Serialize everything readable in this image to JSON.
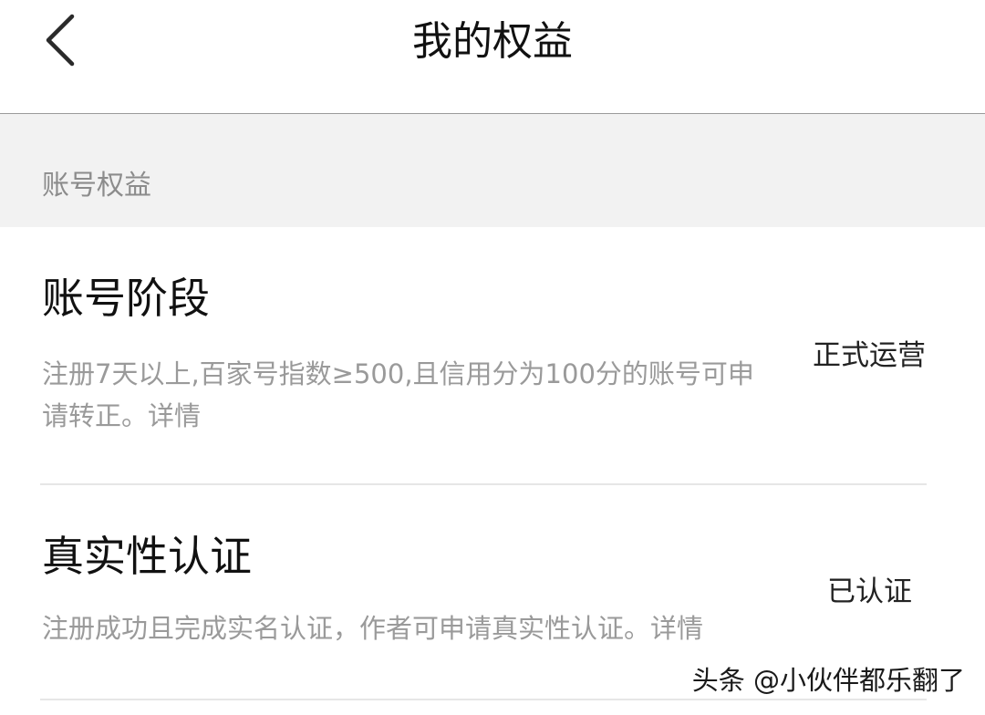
{
  "header": {
    "title": "我的权益",
    "back_icon": "chevron-left-icon"
  },
  "section": {
    "title": "账号权益"
  },
  "rows": [
    {
      "title": "账号阶段",
      "desc_line1": "注册7天以上,百家号指数≥500,且信用分为100分的账号可申",
      "desc_line2": "请转正。详情",
      "status": "正式运营"
    },
    {
      "title": "真实性认证",
      "desc_line1": "注册成功且完成实名认证，作者可申请真实性认证。详情",
      "status": "已认证"
    }
  ],
  "watermark": "头条 @小伙伴都乐翻了",
  "colors": {
    "section_band": "#f2f2f2",
    "desc_text": "#9a9a9a",
    "title_text": "#111111",
    "divider": "#e6e6e6"
  }
}
